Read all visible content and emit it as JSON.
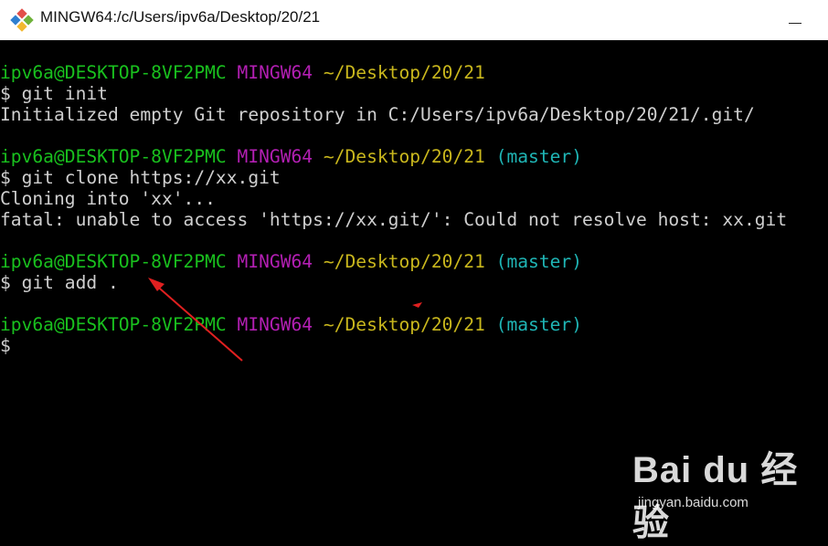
{
  "window": {
    "title": "MINGW64:/c/Users/ipv6a/Desktop/20/21",
    "icon": "git-bash-icon",
    "minimize_label": "minimize"
  },
  "colors": {
    "user": "#19c01e",
    "host": "#b31fb3",
    "path": "#c9b71d",
    "branch": "#1fb5b5",
    "text": "#cfcfcf",
    "arrow": "#e02020"
  },
  "terminal": {
    "prompts": [
      {
        "user": "ipv6a@DESKTOP-8VF2PMC",
        "host": "MINGW64",
        "path": "~/Desktop/20/21",
        "branch": ""
      },
      {
        "user": "ipv6a@DESKTOP-8VF2PMC",
        "host": "MINGW64",
        "path": "~/Desktop/20/21",
        "branch": "(master)"
      },
      {
        "user": "ipv6a@DESKTOP-8VF2PMC",
        "host": "MINGW64",
        "path": "~/Desktop/20/21",
        "branch": "(master)"
      },
      {
        "user": "ipv6a@DESKTOP-8VF2PMC",
        "host": "MINGW64",
        "path": "~/Desktop/20/21",
        "branch": "(master)"
      }
    ],
    "commands": [
      "$ git init",
      "$ git clone https://xx.git",
      "$ git add .",
      "$"
    ],
    "outputs": [
      "Initialized empty Git repository in C:/Users/ipv6a/Desktop/20/21/.git/",
      "Cloning into 'xx'...",
      "fatal: unable to access 'https://xx.git/': Could not resolve host: xx.git"
    ]
  },
  "watermark": {
    "logo": "Bai du 经验",
    "url": "jingyan.baidu.com"
  }
}
